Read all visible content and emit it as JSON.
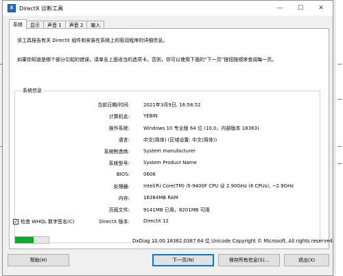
{
  "window": {
    "title": "DirectX 诊断工具",
    "app_icon_text": "X",
    "minimize": "—",
    "maximize": "☐",
    "close": "✕"
  },
  "tabs": [
    {
      "label": "系统",
      "active": true
    },
    {
      "label": "显示",
      "active": false
    },
    {
      "label": "声音 1",
      "active": false
    },
    {
      "label": "声音 2",
      "active": false
    },
    {
      "label": "输入",
      "active": false
    }
  ],
  "intro": {
    "line1": "该工具报告有关 DirectX 组件和安装在系统上的驱动程序的详细信息。",
    "line2": "如果你知道是哪个部分引起的错误，请单击上面适当的选项卡。否则，你可以使用下面的“下一页”按钮按顺序查阅每一页。"
  },
  "system_info": {
    "group_title": "系统信息",
    "rows": [
      {
        "label": "当前日期/时间:",
        "value": "2021年3月9日, 16:58:52"
      },
      {
        "label": "计算机名:",
        "value": "YEBIN"
      },
      {
        "label": "操作系统:",
        "value": "Windows 10 专业版 64 位 (10.0，内部版本 18363)"
      },
      {
        "label": "语言:",
        "value": "中文(简体) (区域设置: 中文(简体))"
      },
      {
        "label": "系统制造商:",
        "value": "System manufacturer"
      },
      {
        "label": "系统型号:",
        "value": "System Product Name"
      },
      {
        "label": "BIOS:",
        "value": "0606"
      },
      {
        "label": "处理器:",
        "value": "Intel(R) Core(TM) i5-9400F CPU @ 2.90GHz (6 CPUs), ~2.9GHz"
      },
      {
        "label": "内存:",
        "value": "16384MB RAM"
      },
      {
        "label": "页面文件:",
        "value": "9141MB 已用，8201MB 可用"
      },
      {
        "label": "DirectX 版本:",
        "value": "DirectX 12"
      }
    ]
  },
  "whql": {
    "label": "检查 WHQL 数字签名(C)",
    "checked": true,
    "check_glyph": "✓"
  },
  "status": {
    "progress_fraction": 0.55,
    "footer": "DxDiag 10.00.18362.0387 64 位 Unicode  Copyright © Microsoft. All rights reserved."
  },
  "buttons": {
    "help": "帮助(H)",
    "next": "下一页(N)",
    "save_all": "保存所有信息(S)...",
    "exit": "退出(X)"
  },
  "colors": {
    "progress": "#06b025",
    "default_button_border": "#0078d7"
  }
}
